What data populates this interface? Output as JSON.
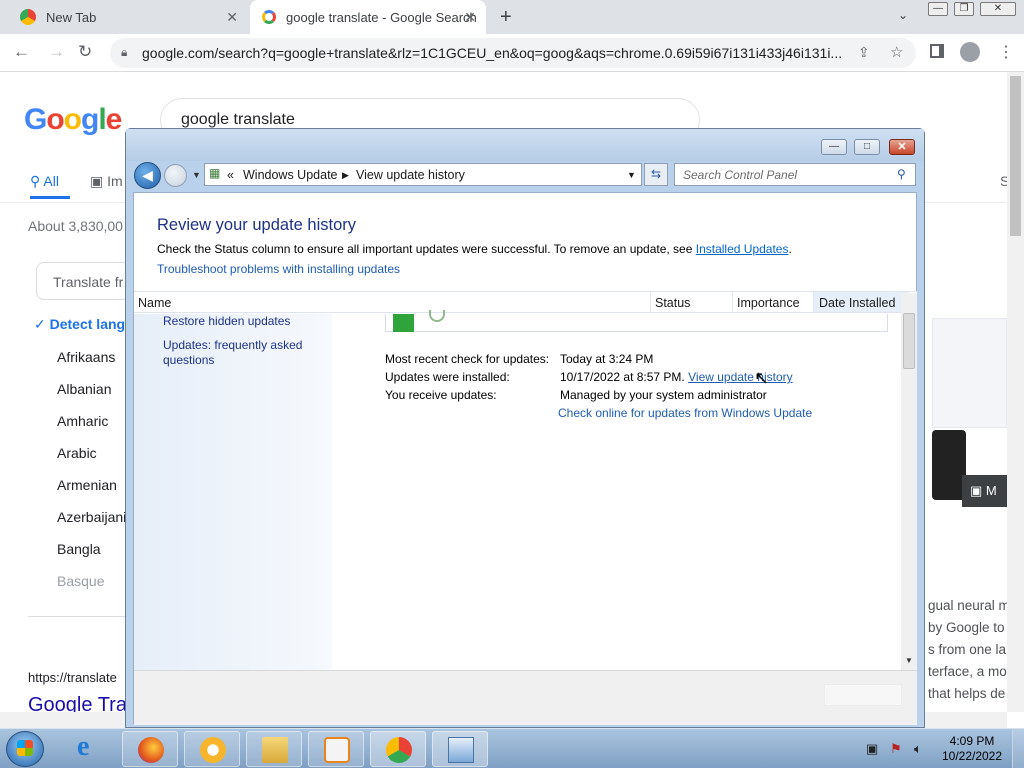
{
  "browser": {
    "tabs": [
      {
        "title": "New Tab",
        "active": false
      },
      {
        "title": "google translate - Google Search",
        "active": true
      }
    ],
    "url": "google.com/search?q=google+translate&rlz=1C1GCEU_en&oq=goog&aqs=chrome.0.69i59i67i131i433j46i131i..."
  },
  "google": {
    "logo": "Google",
    "query": "google translate",
    "tabs": [
      "All",
      "Im"
    ],
    "right_tab": "S",
    "about": "About 3,830,00",
    "translate_from": "Translate fr",
    "detect": "Detect lang",
    "languages": [
      "Afrikaans",
      "Albanian",
      "Amharic",
      "Arabic",
      "Armenian",
      "Azerbaijani",
      "Bangla",
      "Basque"
    ],
    "result_url": "https://translate",
    "result_title": "Google Tra",
    "right_snippet": [
      "gual neural m",
      "by Google to",
      "s from one la",
      "terface, a mo",
      "that helps de"
    ],
    "image_label": "M"
  },
  "dialog": {
    "breadcrumb": [
      "Windows Update",
      "View update history"
    ],
    "breadcrumb_prefix": "«",
    "search_placeholder": "Search Control Panel",
    "title": "Review your update history",
    "description": "Check the Status column to ensure all important updates were successful. To remove an update, see",
    "installed_updates_link": "Installed Updates",
    "description_end": ".",
    "troubleshoot_link": "Troubleshoot problems with installing updates",
    "columns": [
      "Name",
      "Status",
      "Importance",
      "Date Installed"
    ],
    "side_links": [
      "Restore hidden updates",
      "Updates: frequently asked questions"
    ],
    "info": [
      {
        "label": "Most recent check for updates:",
        "value": "Today at 3:24 PM"
      },
      {
        "label": "Updates were installed:",
        "value": "10/17/2022 at 8:57 PM.",
        "link": "View update history"
      },
      {
        "label": "You receive updates:",
        "value": "Managed by your system administrator"
      }
    ],
    "online_link": "Check online for updates from Windows Update"
  },
  "taskbar": {
    "time": "4:09 PM",
    "date": "10/22/2022"
  },
  "colors": {
    "google_blue": "#4285F4",
    "google_red": "#EA4335",
    "google_yellow": "#FBBC05",
    "google_green": "#34A853",
    "dialog_title": "#1e3287",
    "link": "#1e5db0"
  }
}
